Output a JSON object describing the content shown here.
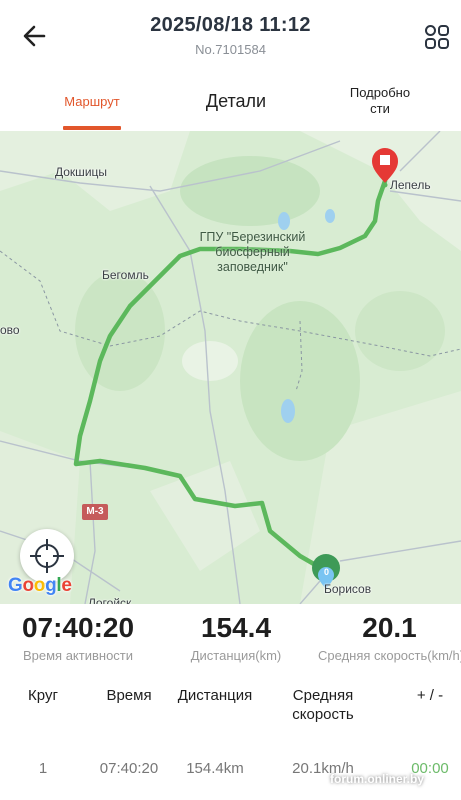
{
  "header": {
    "title": "2025/08/18 11:12",
    "subtitle": "No.7101584",
    "back_icon": "back-arrow-icon",
    "grid_icon": "grid-icon"
  },
  "tabs": [
    {
      "label": "Маршрут",
      "active": true
    },
    {
      "label": "Детали",
      "active": false
    },
    {
      "label": "Подробно\nсти",
      "active": false
    }
  ],
  "map": {
    "places": {
      "dokshitsy": "Докшицы",
      "lepel": "Лепель",
      "begoml": "Бегомль",
      "ovo": "ово",
      "borisov": "Борисов",
      "logoysk": "Логойск"
    },
    "preserve": "ГПУ \"Березинский биосферный заповедник\"",
    "road_shield": "М-3",
    "start_marker_label": "0",
    "attribution": "Google",
    "route_color": "#5cb85c",
    "end_marker_color": "#e53935",
    "start_marker_color": "#3e9a57"
  },
  "stats": [
    {
      "value": "07:40:20",
      "label": "Время активности"
    },
    {
      "value": "154.4",
      "label": "Дистанция(km)"
    },
    {
      "value": "20.1",
      "label": "Средняя скорость(km/h)"
    }
  ],
  "table": {
    "headers": [
      "Круг",
      "Время",
      "Дистанция",
      "Средняя скорость",
      "+ / -"
    ],
    "rows": [
      [
        "1",
        "07:40:20",
        "154.4km",
        "20.1km/h",
        "00:00"
      ]
    ]
  },
  "watermark": "forum.onliner.by",
  "colors": {
    "accent": "#e2562b",
    "positive": "#6dbb6a"
  }
}
